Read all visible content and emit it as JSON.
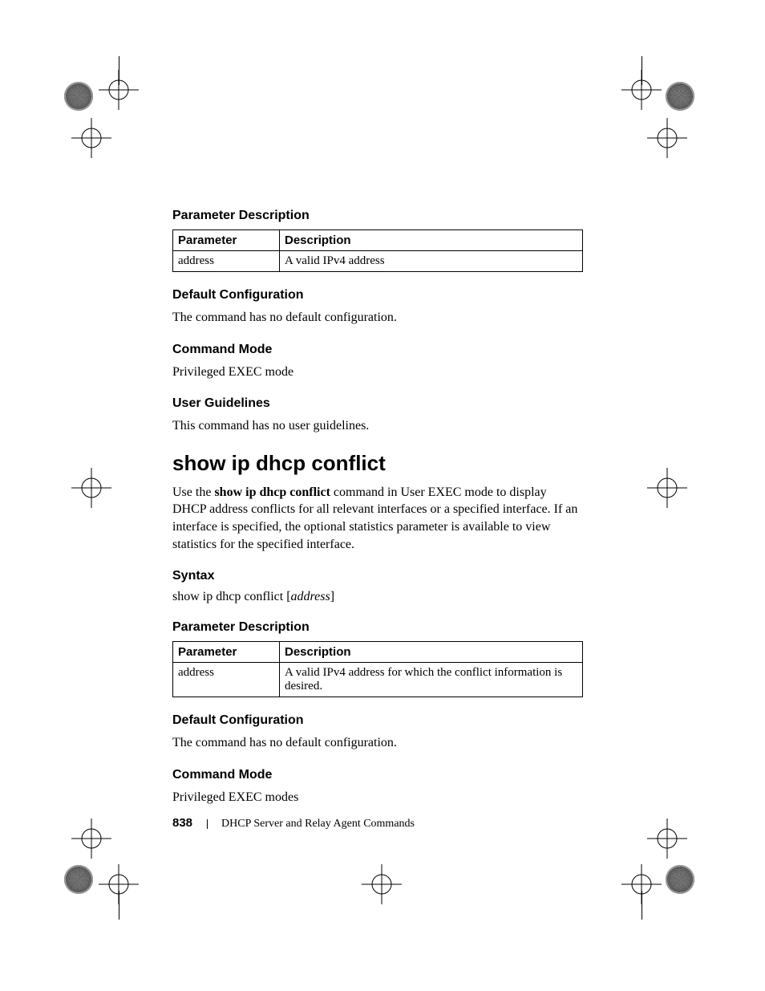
{
  "sections": {
    "param_desc_1": {
      "heading": "Parameter Description",
      "table": {
        "headers": [
          "Parameter",
          "Description"
        ],
        "rows": [
          {
            "param": "address",
            "desc": "A valid IPv4 address"
          }
        ]
      }
    },
    "default_config_1": {
      "heading": "Default Configuration",
      "text": "The command has no default configuration."
    },
    "command_mode_1": {
      "heading": "Command Mode",
      "text": "Privileged EXEC mode"
    },
    "user_guidelines": {
      "heading": "User Guidelines",
      "text": "This command has no user guidelines."
    },
    "command": {
      "title": "show ip dhcp conflict",
      "intro_pre": "Use the ",
      "intro_cmd": "show ip dhcp conflict",
      "intro_post": " command in User EXEC mode to display DHCP address conflicts for all relevant interfaces or a specified interface. If an interface is specified, the optional statistics parameter is available to view statistics for the specified interface."
    },
    "syntax": {
      "heading": "Syntax",
      "line_pre": "show ip dhcp conflict [",
      "line_ital": "address",
      "line_post": "]"
    },
    "param_desc_2": {
      "heading": "Parameter Description",
      "table": {
        "headers": [
          "Parameter",
          "Description"
        ],
        "rows": [
          {
            "param": "address",
            "desc": "A valid IPv4 address for which the conflict information is desired."
          }
        ]
      }
    },
    "default_config_2": {
      "heading": "Default Configuration",
      "text": "The command has no default configuration."
    },
    "command_mode_2": {
      "heading": "Command Mode",
      "text": "Privileged EXEC modes"
    }
  },
  "footer": {
    "page_number": "838",
    "chapter": "DHCP Server and Relay Agent Commands"
  }
}
